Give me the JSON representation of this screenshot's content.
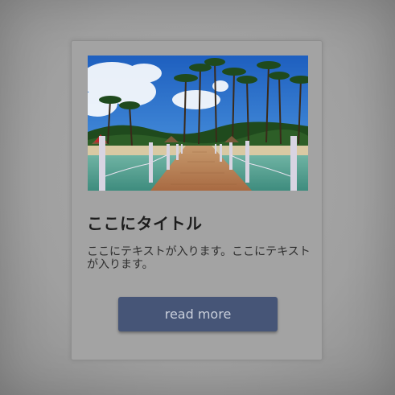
{
  "card": {
    "image_alt": "tropical beach pier with palm trees",
    "title": "ここにタイトル",
    "text": "ここにテキストが入ります。ここにテキストが入ります。",
    "button_label": "read more"
  },
  "colors": {
    "backdrop": "#a0a0a0",
    "card_background": "#a3a3a3",
    "button_background": "#465577",
    "button_text": "#c9cfdb",
    "title_text": "#1d1d1d"
  }
}
